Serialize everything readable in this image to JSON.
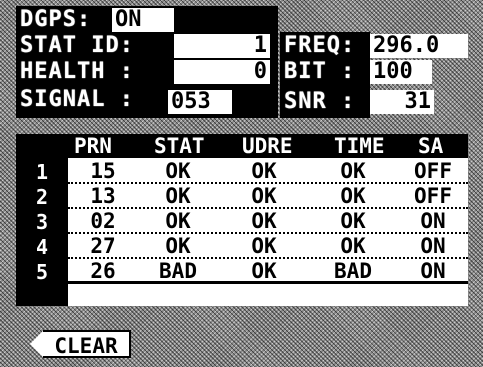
{
  "status": {
    "dgps": {
      "label": "DGPS:",
      "value": "ON"
    },
    "stat_id": {
      "label": "STAT ID:",
      "value": "1"
    },
    "health": {
      "label": "HEALTH :",
      "value": "0"
    },
    "signal": {
      "label": "SIGNAL :",
      "value": "053"
    },
    "freq": {
      "label": "FREQ:",
      "value": "296.0"
    },
    "bit": {
      "label": "BIT  :",
      "value": "100"
    },
    "snr": {
      "label": "SNR  :",
      "value": "31"
    }
  },
  "table": {
    "headers": [
      "PRN",
      "STAT",
      "UDRE",
      "TIME",
      "SA"
    ],
    "rows": [
      {
        "num": "1",
        "prn": "15",
        "stat": "OK",
        "udre": "OK",
        "time": "OK",
        "sa": "OFF"
      },
      {
        "num": "2",
        "prn": "13",
        "stat": "OK",
        "udre": "OK",
        "time": "OK",
        "sa": "OFF"
      },
      {
        "num": "3",
        "prn": "02",
        "stat": "OK",
        "udre": "OK",
        "time": "OK",
        "sa": "ON"
      },
      {
        "num": "4",
        "prn": "27",
        "stat": "OK",
        "udre": "OK",
        "time": "OK",
        "sa": "ON"
      },
      {
        "num": "5",
        "prn": "26",
        "stat": "BAD",
        "udre": "OK",
        "time": "BAD",
        "sa": "ON"
      }
    ]
  },
  "buttons": {
    "clear": "CLEAR"
  }
}
